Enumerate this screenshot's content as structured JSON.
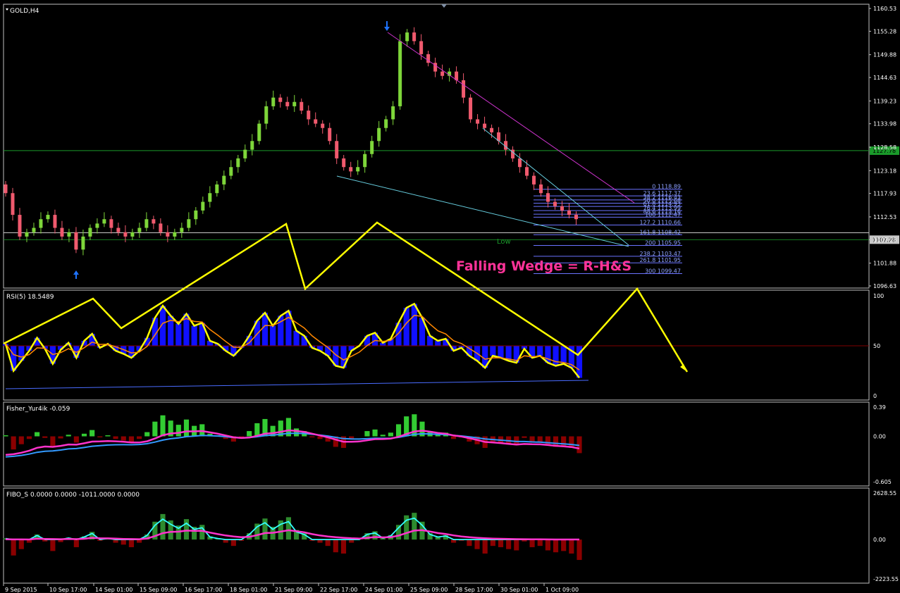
{
  "symbol_label": "GOLD,H4",
  "annotation_text": "Falling Wedge = R-H&S",
  "low_label": "Low",
  "colors": {
    "bull": "#7ed63a",
    "bear": "#f05a6e",
    "grid_border": "#c0c0c0",
    "axis_text": "#ffffff",
    "zigzag": "#ffff00",
    "annotation": "#ff3399",
    "fibo": "#6b73ff",
    "fibo_text": "#8ea2ff",
    "hline_green": "#1a9a2a",
    "rsi_hist": "#1010ff",
    "rsi_line": "#ffff00",
    "fisher_up": "#33cc33",
    "fisher_down": "#8b0000",
    "magenta": "#ff33cc",
    "cyan": "#33ffff",
    "blue_line": "#3399ff",
    "slate": "#8080ff"
  },
  "chart_data": [
    {
      "type": "candlestick",
      "title": "GOLD,H4",
      "price_axis_ticks": [
        "1160.53",
        "1155.28",
        "1149.88",
        "1144.63",
        "1139.23",
        "1133.98",
        "1128.58",
        "1123.18",
        "1117.93",
        "1112.53",
        "1107.28",
        "1101.88",
        "1096.63"
      ],
      "ylim": [
        1096.63,
        1160.53
      ],
      "current_price": "1107.28",
      "hline_price": "1127.78",
      "hline_price_2": "1108.87",
      "time_axis_labels": [
        "9 Sep 2015",
        "10 Sep 17:00",
        "14 Sep 01:00",
        "15 Sep 09:00",
        "16 Sep 17:00",
        "18 Sep 01:00",
        "21 Sep 09:00",
        "22 Sep 17:00",
        "24 Sep 01:00",
        "25 Sep 09:00",
        "28 Sep 17:00",
        "30 Sep 01:00",
        "1 Oct 09:00"
      ],
      "candles_close_approx": [
        1118,
        1113,
        1108,
        1109,
        1110,
        1112,
        1113,
        1110,
        1108,
        1109,
        1105,
        1108,
        1110,
        1111,
        1112,
        1110,
        1109,
        1108,
        1109,
        1110,
        1112,
        1111,
        1109,
        1108,
        1109,
        1110,
        1112,
        1114,
        1116,
        1118,
        1120,
        1122,
        1124,
        1126,
        1128,
        1130,
        1134,
        1138,
        1140,
        1139,
        1138,
        1139,
        1137,
        1135,
        1134,
        1133,
        1130,
        1126,
        1124,
        1123,
        1124,
        1127,
        1130,
        1133,
        1135,
        1138,
        1153,
        1155,
        1153,
        1150,
        1148,
        1146,
        1145,
        1146,
        1144,
        1140,
        1135,
        1134,
        1133,
        1132,
        1130,
        1128,
        1126,
        1124,
        1122,
        1120,
        1118,
        1116,
        1115,
        1114,
        1113,
        1112,
        1111,
        1109,
        1107
      ],
      "fibonacci_levels": [
        {
          "ratio": "0",
          "price": "1118.89"
        },
        {
          "ratio": "23.6",
          "price": "1117.37"
        },
        {
          "ratio": "38.2",
          "price": "1116.43"
        },
        {
          "ratio": "50.0",
          "price": "1115.68"
        },
        {
          "ratio": "61.8",
          "price": "1114.93"
        },
        {
          "ratio": "76.4",
          "price": "1113.99"
        },
        {
          "ratio": "88.6",
          "price": "1113.16"
        },
        {
          "ratio": "100",
          "price": "1112.47"
        },
        {
          "ratio": "127.2",
          "price": "1110.66"
        },
        {
          "ratio": "161.8",
          "price": "1108.42"
        },
        {
          "ratio": "200",
          "price": "1105.95"
        },
        {
          "ratio": "238.2",
          "price": "1103.47"
        },
        {
          "ratio": "261.8",
          "price": "1101.95"
        },
        {
          "ratio": "300",
          "price": "1099.47"
        }
      ]
    },
    {
      "type": "line",
      "title": "RSI(5) 18.5489",
      "axis_ticks": [
        "100",
        "50",
        "0"
      ],
      "ylim": [
        0,
        100
      ],
      "level": 50,
      "values_approx": [
        52,
        25,
        35,
        45,
        58,
        47,
        32,
        46,
        53,
        38,
        55,
        62,
        48,
        52,
        45,
        42,
        38,
        45,
        58,
        78,
        90,
        80,
        72,
        82,
        70,
        73,
        55,
        52,
        45,
        40,
        48,
        60,
        75,
        83,
        70,
        80,
        85,
        65,
        60,
        48,
        45,
        40,
        30,
        28,
        45,
        50,
        60,
        63,
        53,
        57,
        73,
        88,
        92,
        78,
        60,
        55,
        57,
        45,
        48,
        40,
        35,
        28,
        40,
        38,
        35,
        33,
        47,
        38,
        40,
        33,
        30,
        32,
        28,
        18
      ]
    },
    {
      "type": "bar",
      "title": "Fisher_Yur4ik -0.059",
      "axis_ticks": [
        "0.39",
        "0.00",
        "-0.605"
      ],
      "ylim": [
        -0.605,
        0.39
      ]
    },
    {
      "type": "bar",
      "title": "FIBO_S 0.0000 0.0000 -1011.0000 0.0000",
      "axis_ticks": [
        "2628.55",
        "0.00",
        "-2223.55"
      ],
      "ylim": [
        -2223.55,
        2628.55
      ]
    }
  ]
}
